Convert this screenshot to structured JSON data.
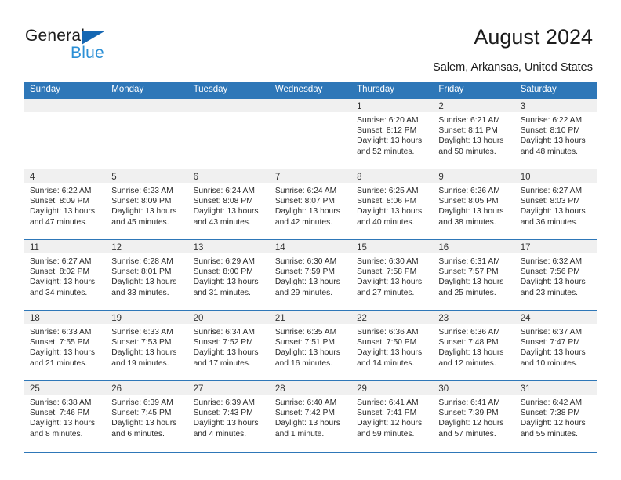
{
  "brand": {
    "name_top": "General",
    "name_bottom": "Blue",
    "triangle_color": "#1567b3",
    "blue_color": "#2a8fd6"
  },
  "header": {
    "title": "August 2024",
    "location": "Salem, Arkansas, United States"
  },
  "theme": {
    "header_blue": "#2e77b8",
    "daynum_bg": "#f0f0f0",
    "text": "#222222"
  },
  "weekdays": [
    "Sunday",
    "Monday",
    "Tuesday",
    "Wednesday",
    "Thursday",
    "Friday",
    "Saturday"
  ],
  "labels": {
    "sunrise_prefix": "Sunrise:",
    "sunset_prefix": "Sunset:",
    "daylight_prefix": "Daylight:"
  },
  "weeks": [
    [
      {
        "day": "",
        "empty": true
      },
      {
        "day": "",
        "empty": true
      },
      {
        "day": "",
        "empty": true
      },
      {
        "day": "",
        "empty": true
      },
      {
        "day": "1",
        "sunrise": "Sunrise: 6:20 AM",
        "sunset": "Sunset: 8:12 PM",
        "daylight1": "Daylight: 13 hours",
        "daylight2": "and 52 minutes."
      },
      {
        "day": "2",
        "sunrise": "Sunrise: 6:21 AM",
        "sunset": "Sunset: 8:11 PM",
        "daylight1": "Daylight: 13 hours",
        "daylight2": "and 50 minutes."
      },
      {
        "day": "3",
        "sunrise": "Sunrise: 6:22 AM",
        "sunset": "Sunset: 8:10 PM",
        "daylight1": "Daylight: 13 hours",
        "daylight2": "and 48 minutes."
      }
    ],
    [
      {
        "day": "4",
        "sunrise": "Sunrise: 6:22 AM",
        "sunset": "Sunset: 8:09 PM",
        "daylight1": "Daylight: 13 hours",
        "daylight2": "and 47 minutes."
      },
      {
        "day": "5",
        "sunrise": "Sunrise: 6:23 AM",
        "sunset": "Sunset: 8:09 PM",
        "daylight1": "Daylight: 13 hours",
        "daylight2": "and 45 minutes."
      },
      {
        "day": "6",
        "sunrise": "Sunrise: 6:24 AM",
        "sunset": "Sunset: 8:08 PM",
        "daylight1": "Daylight: 13 hours",
        "daylight2": "and 43 minutes."
      },
      {
        "day": "7",
        "sunrise": "Sunrise: 6:24 AM",
        "sunset": "Sunset: 8:07 PM",
        "daylight1": "Daylight: 13 hours",
        "daylight2": "and 42 minutes."
      },
      {
        "day": "8",
        "sunrise": "Sunrise: 6:25 AM",
        "sunset": "Sunset: 8:06 PM",
        "daylight1": "Daylight: 13 hours",
        "daylight2": "and 40 minutes."
      },
      {
        "day": "9",
        "sunrise": "Sunrise: 6:26 AM",
        "sunset": "Sunset: 8:05 PM",
        "daylight1": "Daylight: 13 hours",
        "daylight2": "and 38 minutes."
      },
      {
        "day": "10",
        "sunrise": "Sunrise: 6:27 AM",
        "sunset": "Sunset: 8:03 PM",
        "daylight1": "Daylight: 13 hours",
        "daylight2": "and 36 minutes."
      }
    ],
    [
      {
        "day": "11",
        "sunrise": "Sunrise: 6:27 AM",
        "sunset": "Sunset: 8:02 PM",
        "daylight1": "Daylight: 13 hours",
        "daylight2": "and 34 minutes."
      },
      {
        "day": "12",
        "sunrise": "Sunrise: 6:28 AM",
        "sunset": "Sunset: 8:01 PM",
        "daylight1": "Daylight: 13 hours",
        "daylight2": "and 33 minutes."
      },
      {
        "day": "13",
        "sunrise": "Sunrise: 6:29 AM",
        "sunset": "Sunset: 8:00 PM",
        "daylight1": "Daylight: 13 hours",
        "daylight2": "and 31 minutes."
      },
      {
        "day": "14",
        "sunrise": "Sunrise: 6:30 AM",
        "sunset": "Sunset: 7:59 PM",
        "daylight1": "Daylight: 13 hours",
        "daylight2": "and 29 minutes."
      },
      {
        "day": "15",
        "sunrise": "Sunrise: 6:30 AM",
        "sunset": "Sunset: 7:58 PM",
        "daylight1": "Daylight: 13 hours",
        "daylight2": "and 27 minutes."
      },
      {
        "day": "16",
        "sunrise": "Sunrise: 6:31 AM",
        "sunset": "Sunset: 7:57 PM",
        "daylight1": "Daylight: 13 hours",
        "daylight2": "and 25 minutes."
      },
      {
        "day": "17",
        "sunrise": "Sunrise: 6:32 AM",
        "sunset": "Sunset: 7:56 PM",
        "daylight1": "Daylight: 13 hours",
        "daylight2": "and 23 minutes."
      }
    ],
    [
      {
        "day": "18",
        "sunrise": "Sunrise: 6:33 AM",
        "sunset": "Sunset: 7:55 PM",
        "daylight1": "Daylight: 13 hours",
        "daylight2": "and 21 minutes."
      },
      {
        "day": "19",
        "sunrise": "Sunrise: 6:33 AM",
        "sunset": "Sunset: 7:53 PM",
        "daylight1": "Daylight: 13 hours",
        "daylight2": "and 19 minutes."
      },
      {
        "day": "20",
        "sunrise": "Sunrise: 6:34 AM",
        "sunset": "Sunset: 7:52 PM",
        "daylight1": "Daylight: 13 hours",
        "daylight2": "and 17 minutes."
      },
      {
        "day": "21",
        "sunrise": "Sunrise: 6:35 AM",
        "sunset": "Sunset: 7:51 PM",
        "daylight1": "Daylight: 13 hours",
        "daylight2": "and 16 minutes."
      },
      {
        "day": "22",
        "sunrise": "Sunrise: 6:36 AM",
        "sunset": "Sunset: 7:50 PM",
        "daylight1": "Daylight: 13 hours",
        "daylight2": "and 14 minutes."
      },
      {
        "day": "23",
        "sunrise": "Sunrise: 6:36 AM",
        "sunset": "Sunset: 7:48 PM",
        "daylight1": "Daylight: 13 hours",
        "daylight2": "and 12 minutes."
      },
      {
        "day": "24",
        "sunrise": "Sunrise: 6:37 AM",
        "sunset": "Sunset: 7:47 PM",
        "daylight1": "Daylight: 13 hours",
        "daylight2": "and 10 minutes."
      }
    ],
    [
      {
        "day": "25",
        "sunrise": "Sunrise: 6:38 AM",
        "sunset": "Sunset: 7:46 PM",
        "daylight1": "Daylight: 13 hours",
        "daylight2": "and 8 minutes."
      },
      {
        "day": "26",
        "sunrise": "Sunrise: 6:39 AM",
        "sunset": "Sunset: 7:45 PM",
        "daylight1": "Daylight: 13 hours",
        "daylight2": "and 6 minutes."
      },
      {
        "day": "27",
        "sunrise": "Sunrise: 6:39 AM",
        "sunset": "Sunset: 7:43 PM",
        "daylight1": "Daylight: 13 hours",
        "daylight2": "and 4 minutes."
      },
      {
        "day": "28",
        "sunrise": "Sunrise: 6:40 AM",
        "sunset": "Sunset: 7:42 PM",
        "daylight1": "Daylight: 13 hours",
        "daylight2": "and 1 minute."
      },
      {
        "day": "29",
        "sunrise": "Sunrise: 6:41 AM",
        "sunset": "Sunset: 7:41 PM",
        "daylight1": "Daylight: 12 hours",
        "daylight2": "and 59 minutes."
      },
      {
        "day": "30",
        "sunrise": "Sunrise: 6:41 AM",
        "sunset": "Sunset: 7:39 PM",
        "daylight1": "Daylight: 12 hours",
        "daylight2": "and 57 minutes."
      },
      {
        "day": "31",
        "sunrise": "Sunrise: 6:42 AM",
        "sunset": "Sunset: 7:38 PM",
        "daylight1": "Daylight: 12 hours",
        "daylight2": "and 55 minutes."
      }
    ]
  ]
}
